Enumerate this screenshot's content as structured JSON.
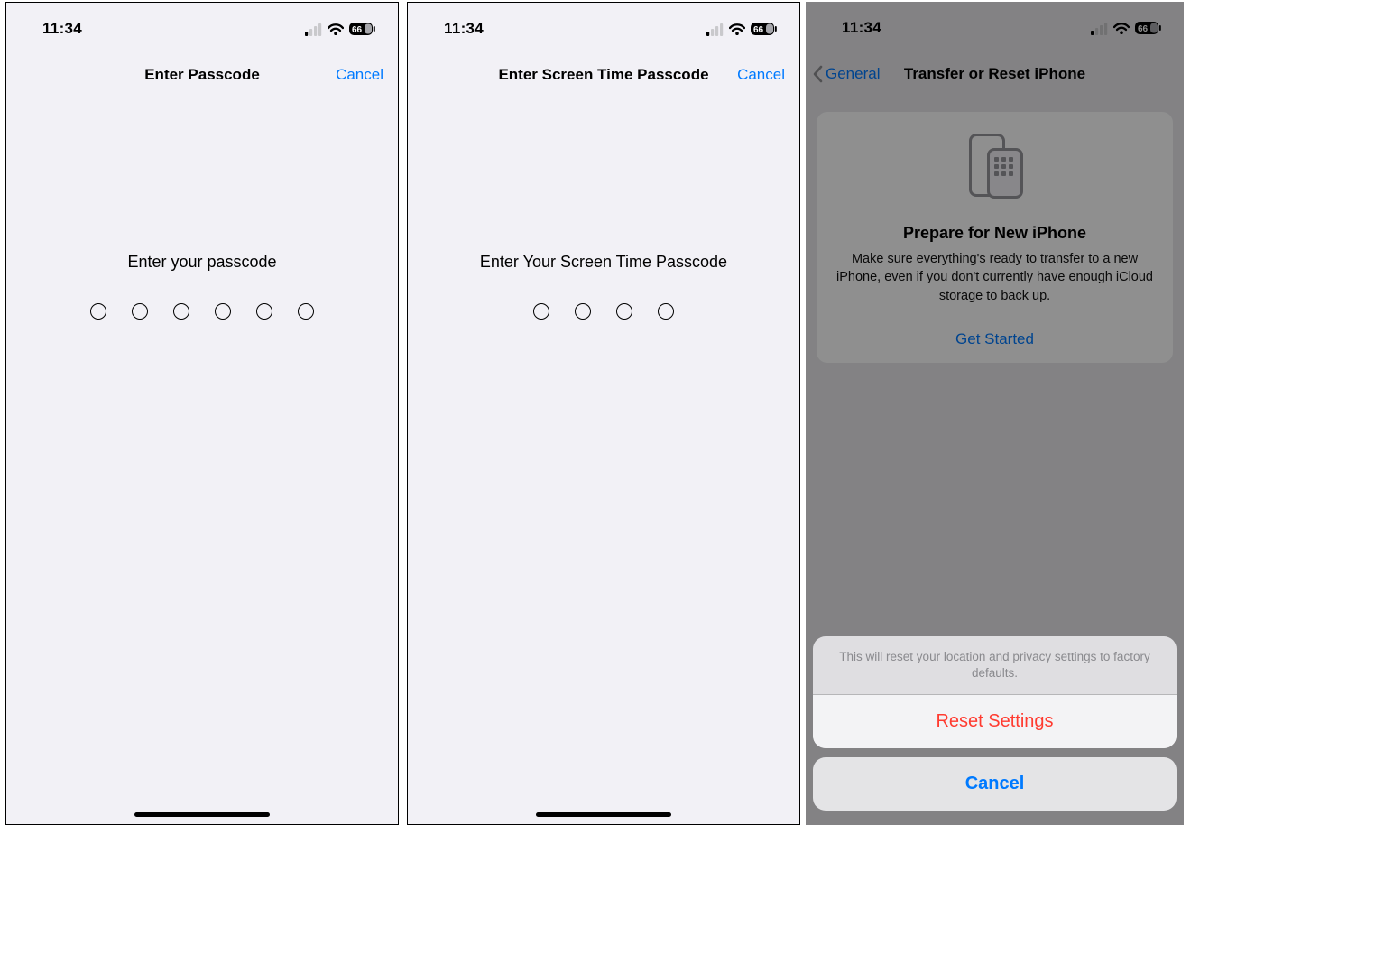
{
  "status": {
    "time": "11:34",
    "battery": "66"
  },
  "links": {
    "cancel": "Cancel"
  },
  "phone1": {
    "nav_title": "Enter Passcode",
    "prompt": "Enter your passcode",
    "dot_count": 6
  },
  "phone2": {
    "nav_title": "Enter Screen Time Passcode",
    "prompt": "Enter Your Screen Time Passcode",
    "dot_count": 4
  },
  "phone3": {
    "back_label": "General",
    "nav_title": "Transfer or Reset iPhone",
    "card_title": "Prepare for New iPhone",
    "card_desc": "Make sure everything's ready to transfer to a new iPhone, even if you don't currently have enough iCloud storage to back up.",
    "card_link": "Get Started",
    "sheet_msg": "This will reset your location and privacy settings to factory defaults.",
    "sheet_action": "Reset Settings",
    "sheet_cancel": "Cancel"
  }
}
